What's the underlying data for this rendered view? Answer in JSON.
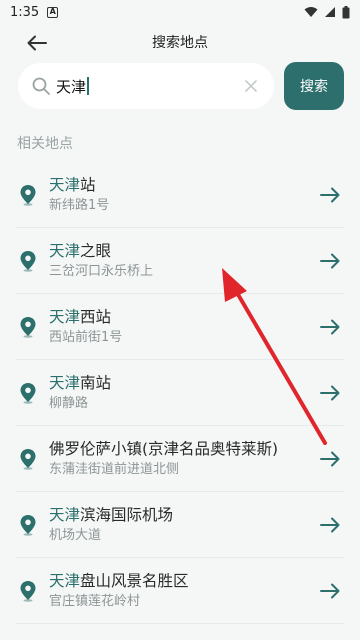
{
  "status": {
    "time": "1:35",
    "a_badge": "A"
  },
  "nav": {
    "title": "搜索地点"
  },
  "search": {
    "query": "天津",
    "button_label": "搜索"
  },
  "section": {
    "label": "相关地点"
  },
  "results": [
    {
      "highlight": "天津",
      "rest": "站",
      "address": "新纬路1号"
    },
    {
      "highlight": "天津",
      "rest": "之眼",
      "address": "三岔河口永乐桥上"
    },
    {
      "highlight": "天津",
      "rest": "西站",
      "address": "西站前街1号"
    },
    {
      "highlight": "天津",
      "rest": "南站",
      "address": "柳静路"
    },
    {
      "highlight": "",
      "rest": "佛罗伦萨小镇(京津名品奥特莱斯)",
      "address": "东蒲洼街道前进道北侧"
    },
    {
      "highlight": "天津",
      "rest": "滨海国际机场",
      "address": "机场大道"
    },
    {
      "highlight": "天津",
      "rest": "盘山风景名胜区",
      "address": "官庄镇莲花岭村"
    }
  ],
  "colors": {
    "accent": "#2c6f6c",
    "annotation_arrow": "#e0262b"
  },
  "icons": {
    "back": "arrow-left-icon",
    "search": "magnifier-icon",
    "clear": "close-icon",
    "pin": "map-pin-icon",
    "go": "arrow-right-icon"
  }
}
